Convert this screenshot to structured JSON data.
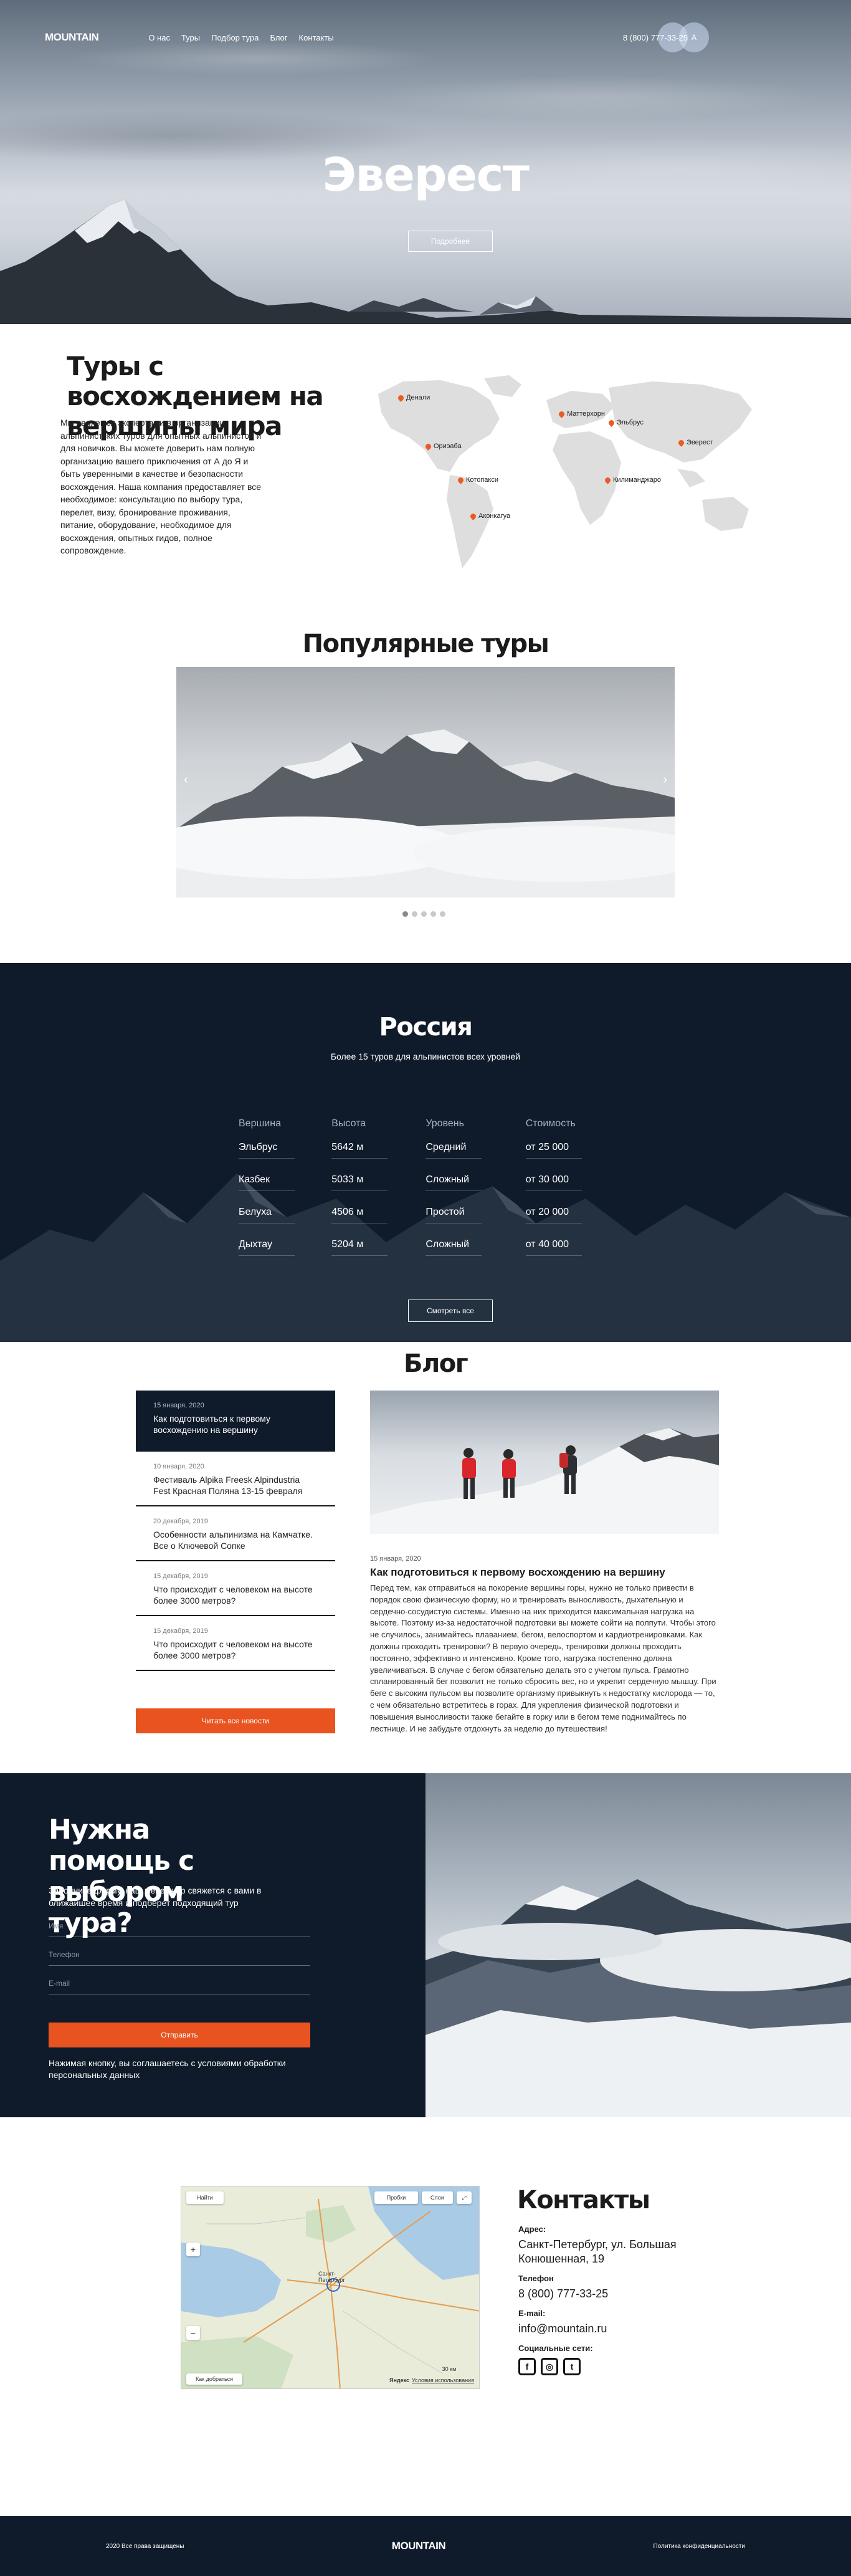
{
  "nav": {
    "logo": "MOUNTAIN",
    "items": [
      "О нас",
      "Туры",
      "Подбор тура",
      "Блог",
      "Контакты"
    ],
    "phone": "8 (800) 777-33-25",
    "lang": "A"
  },
  "hero": {
    "title": "Эверест",
    "more": "Подробнее"
  },
  "intro": {
    "title": "Туры с восхождением на вершины мира",
    "text": "Мы являемся экспертами в организации альпинистских туров для опытных альпинистов и для новичков. Вы можете доверить нам полную организацию вашего приключения от А до Я и быть уверенными в качестве и безопасности восхождения. Наша компания предоставляет все необходимое: консультацию по выбору тура, перелет, визу, бронирование проживания, питание, оборудование, необходимое для восхождения, опытных гидов, полное сопровождение.",
    "pins": [
      "Денали",
      "Маттерхорн",
      "Эльбрус",
      "Эверест",
      "Ориэаба",
      "Котопакси",
      "Килиманджаро",
      "Аконкагуа"
    ]
  },
  "tours": {
    "title": "Популярные туры",
    "prev": "‹",
    "next": "›"
  },
  "russia": {
    "title": "Россия",
    "subtitle": "Более 15 туров для альпинистов всех уровней",
    "headers": [
      "Вершина",
      "Высота",
      "Уровень",
      "Стоимость"
    ],
    "rows": [
      [
        "Эльбрус",
        "5642 м",
        "Средний",
        "от 25 000"
      ],
      [
        "Казбек",
        "5033 м",
        "Сложный",
        "от 30 000"
      ],
      [
        "Белуха",
        "4506 м",
        "Простой",
        "от 20 000"
      ],
      [
        "Дыхтау",
        "5204 м",
        "Сложный",
        "от 40 000"
      ]
    ],
    "button": "Смотреть все"
  },
  "blog": {
    "title": "Блог",
    "posts": [
      {
        "date": "15 января, 2020",
        "title": "Как подготовиться к первому восхождению на вершину"
      },
      {
        "date": "10 января, 2020",
        "title": "Фестиваль Alpika Freesk Alpindustria Fest Красная Поляна 13-15 февраля"
      },
      {
        "date": "20 декабря, 2019",
        "title": "Особенности альпинизма на Камчатке. Все о Ключевой Сопке"
      },
      {
        "date": "15 декабря, 2019",
        "title": "Что происходит с человеком на высоте более 3000 метров?"
      },
      {
        "date": "15 декабря, 2019",
        "title": "Что происходит с человеком на высоте более 3000 метров?"
      }
    ],
    "read_all": "Читать все новости",
    "featured": {
      "date": "15 января, 2020",
      "title": "Как подготовиться к первому восхождению на вершину",
      "body": "Перед тем, как отправиться на покорение вершины горы, нужно не только привести в порядок свою физическую форму, но и тренировать выносливость, дыхательную и сердечно-сосудистую системы. Именно на них приходится максимальная нагрузка на высоте. Поэтому из-за недостаточной подготовки вы можете сойти на полпути. Чтобы этого не случилось, занимайтесь плаванием, бегом, велоспортом и кардиотренировками. Как должны проходить тренировки? В первую очередь, тренировки должны проходить постоянно, эффективно и интенсивно. Кроме того, нагрузка постепенно должна увеличиваться. В случае с бегом обязательно делать это с учетом пульса. Грамотно спланированный бег позволит не только сбросить вес, но и укрепит сердечную мышцу. При беге с высоким пульсом вы позволите организму привыкнуть к недостатку кислорода — то, с чем обязательно встретитесь в горах. Для укрепления физической подготовки и повышения выносливости также бегайте в горку или в бегом теме поднимайтесь по лестнице. И не забудьте отдохнуть за неделю до путешествия!"
    }
  },
  "help": {
    "title": "Нужна помощь с выбором тура?",
    "lead": "Заполните форму, наш менеджер свяжется с вами в ближайшее время и подберет подходящий тур",
    "name_placeholder": "Имя",
    "phone_placeholder": "Телефон",
    "email_placeholder": "E-mail",
    "send": "Отправить",
    "agree": "Нажимая кнопку, вы соглашаетесь с условиями обработки персональных данных"
  },
  "map": {
    "find": "Найти",
    "route": "Пробки",
    "layers": "Слои",
    "city": "Санкт-Петербург",
    "how": "Как добраться",
    "yandex": "Яндекс",
    "terms": "Условия использования",
    "scale": "30 км"
  },
  "contacts": {
    "title": "Контакты",
    "address_label": "Адрес:",
    "address": "Санкт-Петербург, ул. Большая Конюшенная, 19",
    "phone_label": "Телефон",
    "phone": "8 (800) 777-33-25",
    "email_label": "E-mail:",
    "email": "info@mountain.ru",
    "social_label": "Социальные сети:",
    "social": [
      "f",
      "◎",
      "t"
    ]
  },
  "footer": {
    "copyright": "2020 Все права защищены",
    "logo": "MOUNTAIN",
    "privacy": "Политика конфиденциальности"
  },
  "colors": {
    "accent": "#e8531f",
    "dark": "#0f1b2a",
    "pin": "#ec5a24"
  }
}
